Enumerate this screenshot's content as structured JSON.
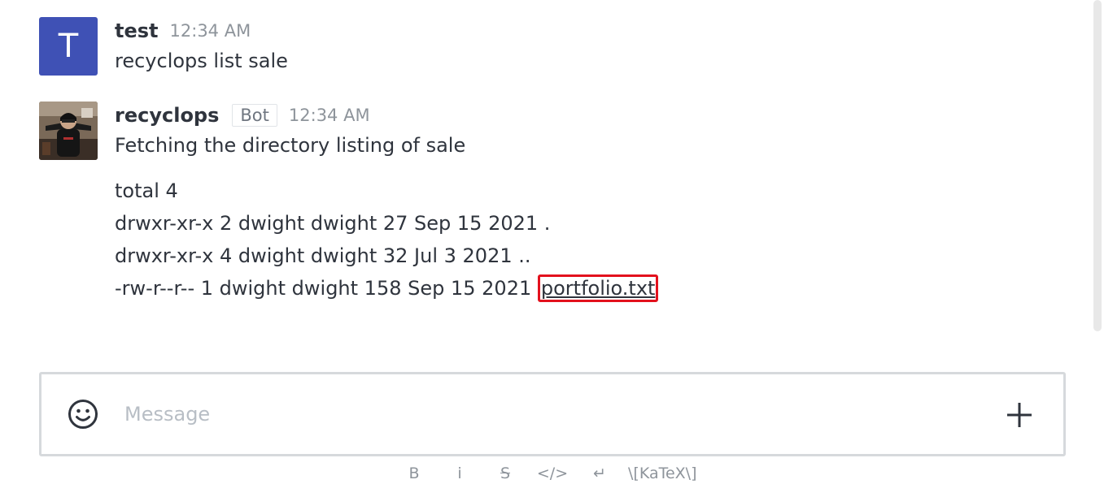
{
  "messages": [
    {
      "avatar_letter": "T",
      "avatar_color": "#3f51b5",
      "username": "test",
      "time": "12:34 AM",
      "text": "recyclops list sale"
    },
    {
      "avatar": "user-photo",
      "username": "recyclops",
      "badge": "Bot",
      "time": "12:34 AM",
      "text": "Fetching the directory listing of sale",
      "listing": [
        "total 4",
        "drwxr-xr-x 2 dwight dwight 27 Sep 15 2021 .",
        "drwxr-xr-x 4 dwight dwight 32 Jul 3 2021 ..",
        "-rw-r--r-- 1 dwight dwight 158 Sep 15 2021"
      ],
      "file_link": "portfolio.txt"
    }
  ],
  "composer": {
    "placeholder": "Message",
    "emoji_icon": "smiley-icon",
    "plus_icon": "plus-icon"
  },
  "toolbar": {
    "bold": "B",
    "italic": "i",
    "strike": "S",
    "code": "</>",
    "enter": "↵",
    "katex": "\\[KaTeX\\]"
  },
  "highlight_color": "#e3111d"
}
